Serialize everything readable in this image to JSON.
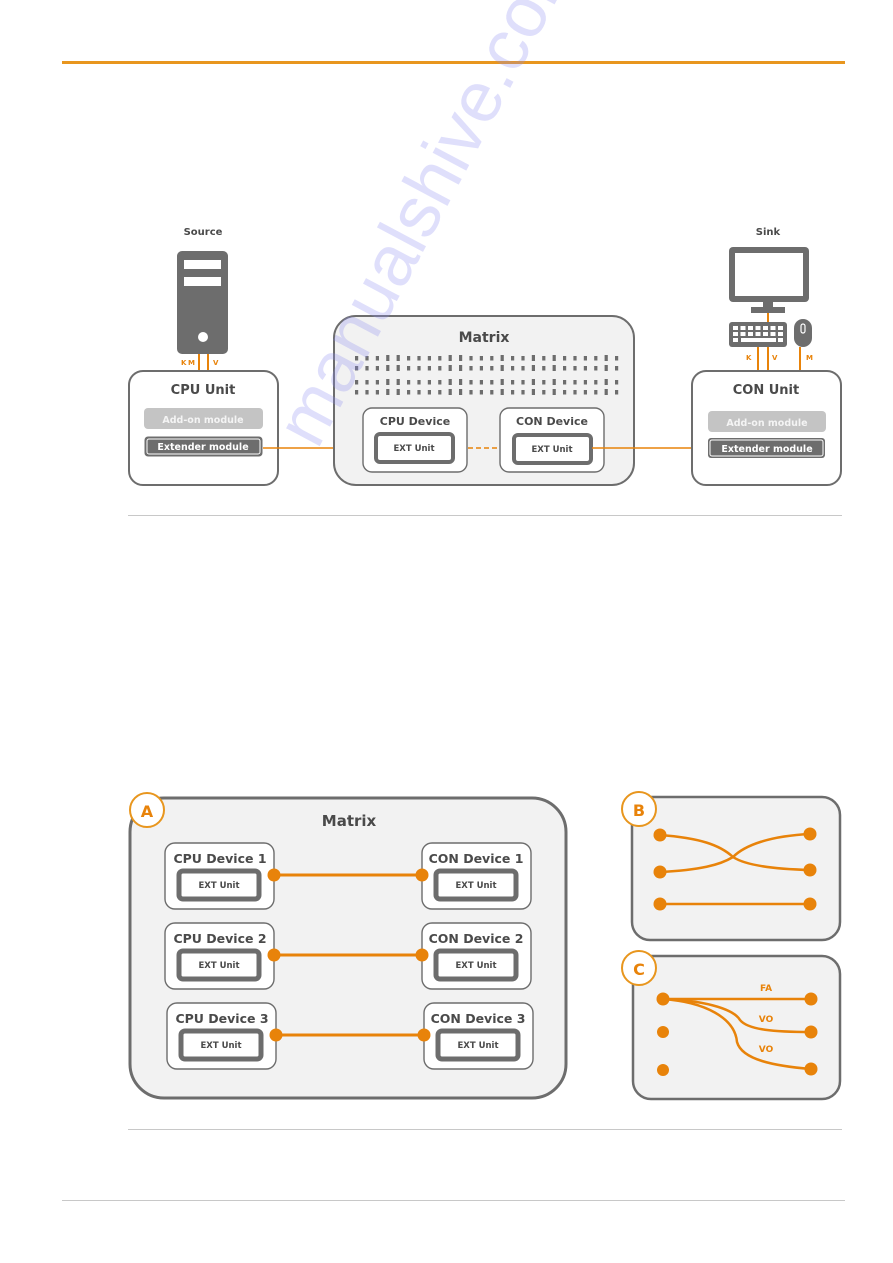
{
  "colors": {
    "accent": "#e8961e",
    "orange_line": "#e8830a",
    "box_stroke": "#6d6d6d",
    "box_fill_light": "#f2f2f2",
    "module_dark": "#6d6d6d",
    "module_light": "#c4c4c4",
    "text_dark": "#4a4a4a"
  },
  "diagram1": {
    "source_label": "Source",
    "sink_label": "Sink",
    "source_cables": [
      "K",
      "M",
      "V"
    ],
    "sink_cables": [
      "K",
      "V",
      "M"
    ],
    "cpu_unit": {
      "title": "CPU Unit",
      "addon_module": "Add-on module",
      "extender_module": "Extender module"
    },
    "matrix": {
      "title": "Matrix",
      "cpu_device": {
        "title": "CPU Device",
        "ext_unit": "EXT Unit"
      },
      "con_device": {
        "title": "CON Device",
        "ext_unit": "EXT Unit"
      }
    },
    "con_unit": {
      "title": "CON Unit",
      "addon_module": "Add-on module",
      "extender_module": "Extender module"
    }
  },
  "diagram2": {
    "panel_a": {
      "badge": "A",
      "title": "Matrix",
      "rows": [
        {
          "cpu": "CPU Device 1",
          "con": "CON Device 1",
          "ext": "EXT Unit"
        },
        {
          "cpu": "CPU Device 2",
          "con": "CON Device 2",
          "ext": "EXT Unit"
        },
        {
          "cpu": "CPU Device 3",
          "con": "CON Device 3",
          "ext": "EXT Unit"
        }
      ]
    },
    "panel_b": {
      "badge": "B"
    },
    "panel_c": {
      "badge": "C",
      "labels": [
        "FA",
        "VO",
        "VO"
      ]
    }
  },
  "watermark": "manualshive.com"
}
